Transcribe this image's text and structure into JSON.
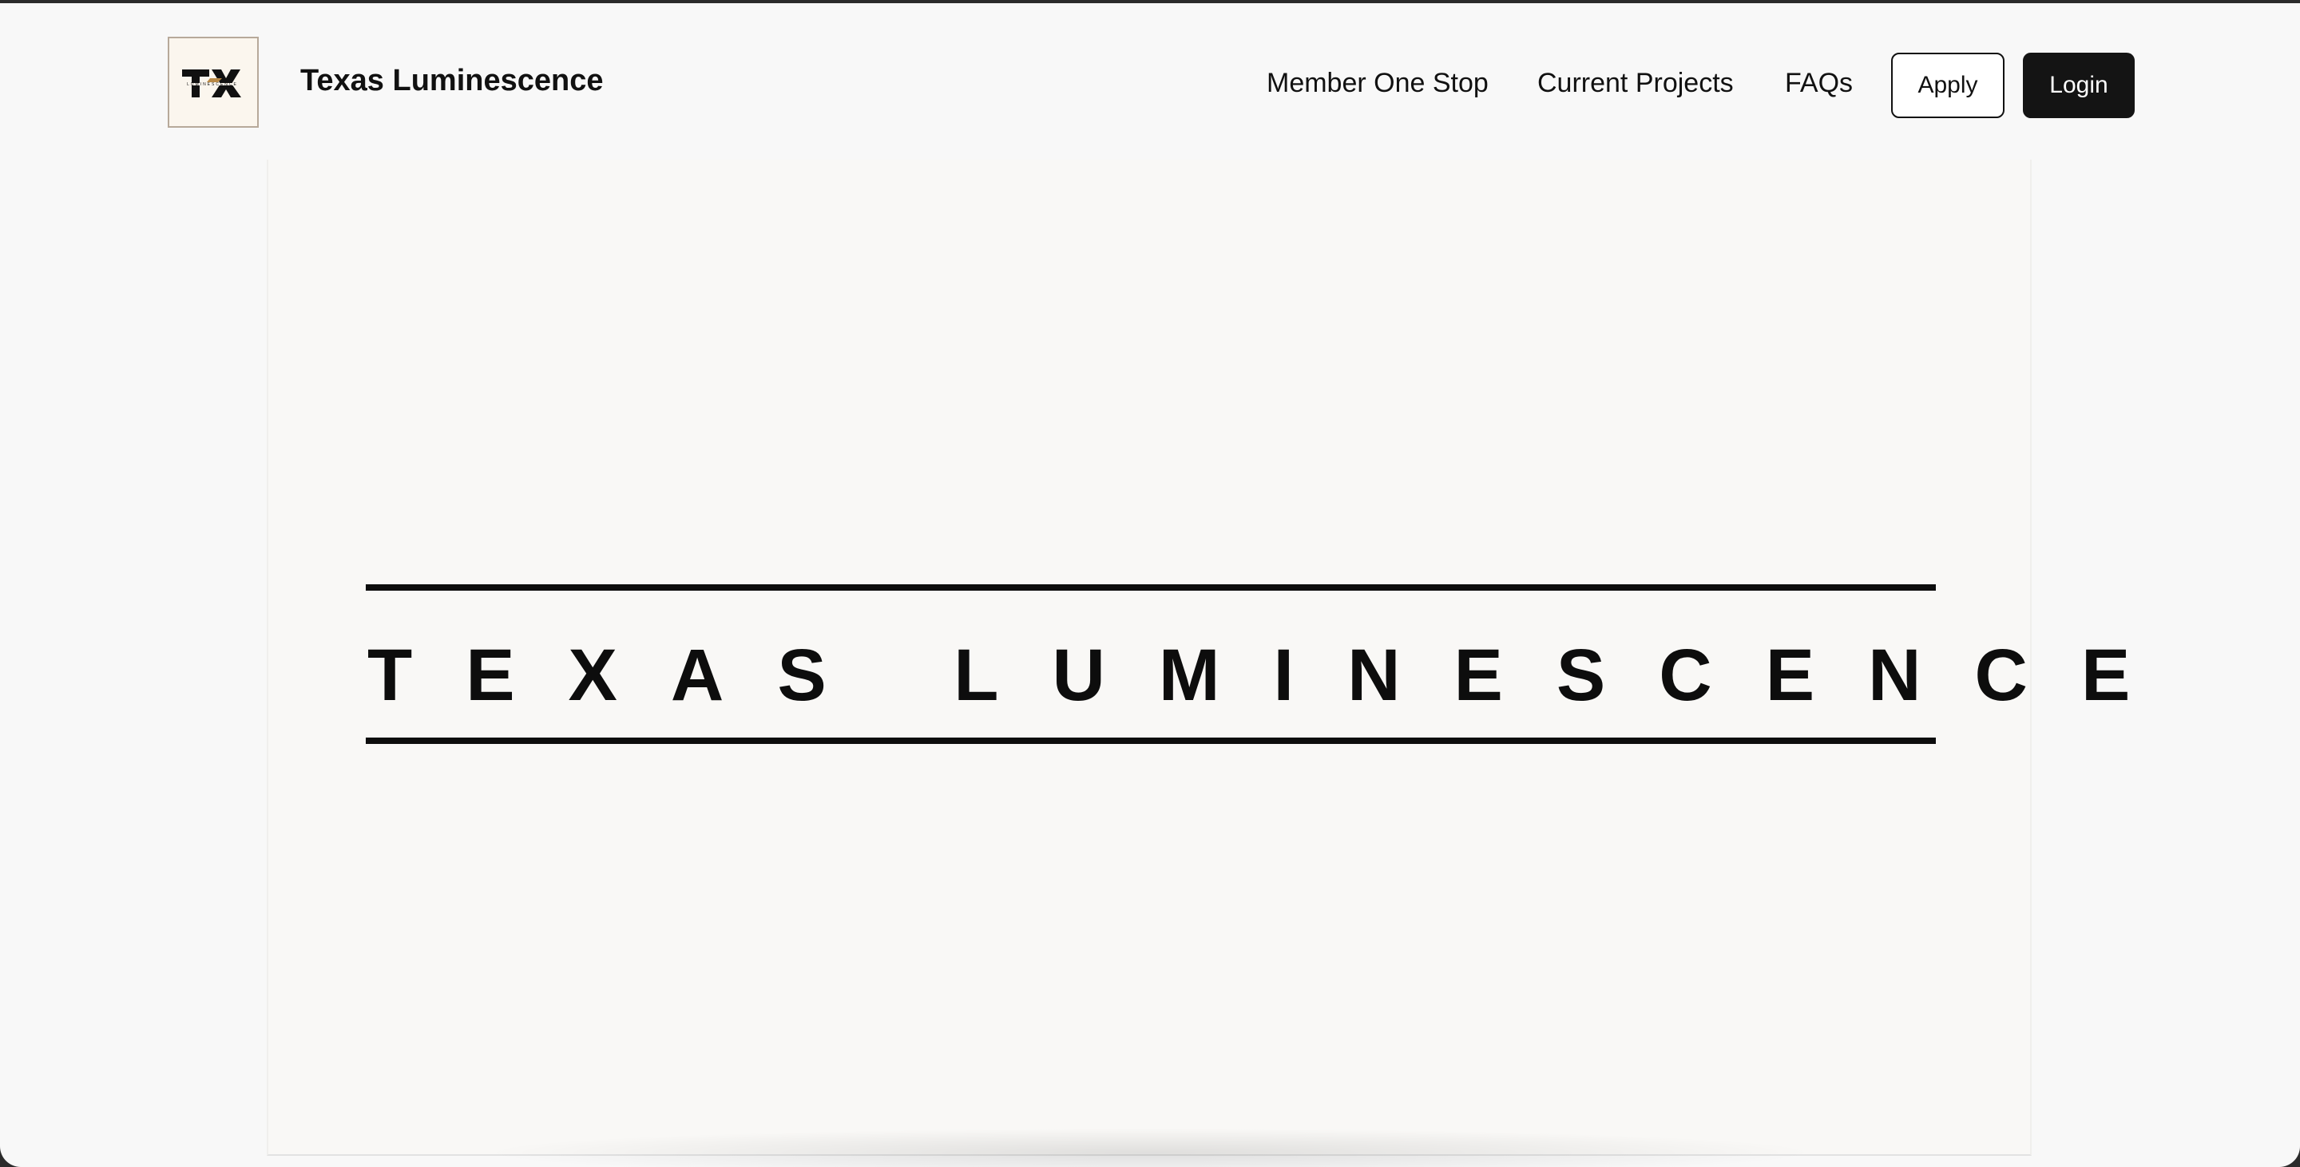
{
  "brand": {
    "logo_text": "TX",
    "logo_subtext": "LUMINESCENCE",
    "name": "Texas Luminescence"
  },
  "nav": {
    "member_one_stop": "Member One Stop",
    "current_projects": "Current Projects",
    "faqs": "FAQs"
  },
  "actions": {
    "apply": "Apply",
    "login": "Login"
  },
  "hero": {
    "title": "TEXAS LUMINESCENCE"
  },
  "colors": {
    "page_background": "#f8f8f8",
    "text": "#111111",
    "login_button": "#141414",
    "logo_background": "#fbf6ee"
  }
}
